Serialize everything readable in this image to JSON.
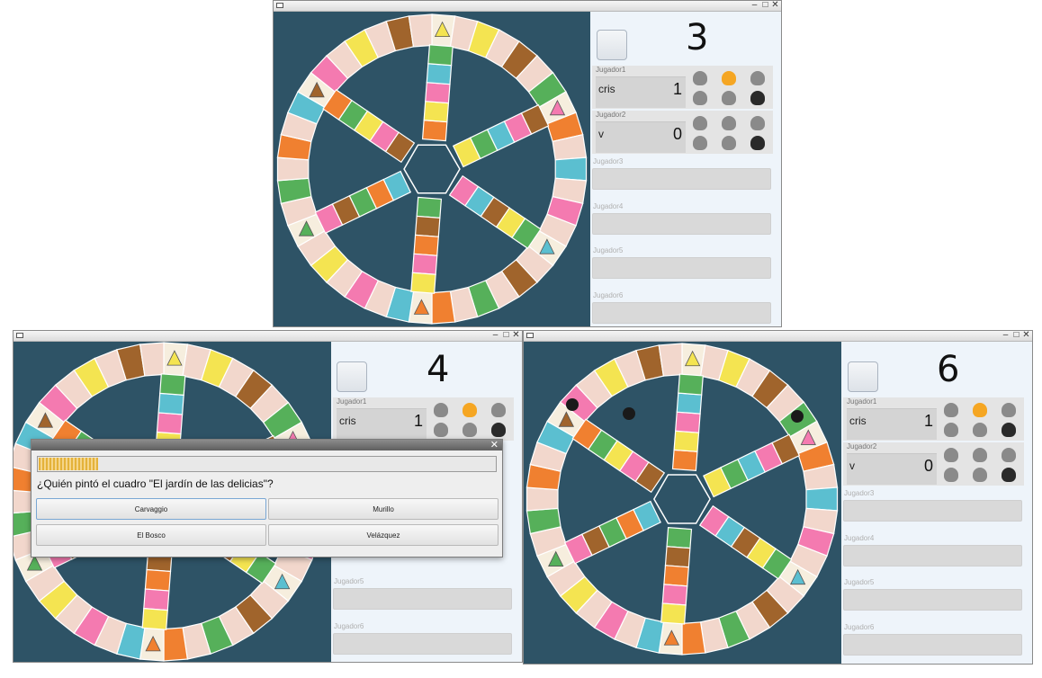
{
  "windows": [
    {
      "id": "top",
      "dice_value": "3",
      "players": [
        {
          "label": "Jugador1",
          "name": "cris",
          "score": "1",
          "wedges": [
            "grey",
            "orange",
            "grey",
            "grey",
            "grey",
            "black"
          ]
        },
        {
          "label": "Jugador2",
          "name": "v",
          "score": "0",
          "wedges": [
            "grey",
            "grey",
            "grey",
            "grey",
            "grey",
            "black"
          ]
        }
      ],
      "empty_slots": [
        "Jugador3",
        "Jugador4",
        "Jugador5",
        "Jugador6"
      ]
    },
    {
      "id": "bottom-left",
      "dice_value": "4",
      "players": [
        {
          "label": "Jugador1",
          "name": "cris",
          "score": "1",
          "wedges": [
            "grey",
            "orange",
            "grey",
            "grey",
            "grey",
            "black"
          ]
        }
      ],
      "empty_slots": [
        "Jugador5",
        "Jugador6"
      ]
    },
    {
      "id": "bottom-right",
      "dice_value": "6",
      "players": [
        {
          "label": "Jugador1",
          "name": "cris",
          "score": "1",
          "wedges": [
            "grey",
            "orange",
            "grey",
            "grey",
            "grey",
            "black"
          ]
        },
        {
          "label": "Jugador2",
          "name": "v",
          "score": "0",
          "wedges": [
            "grey",
            "grey",
            "grey",
            "grey",
            "grey",
            "black"
          ]
        }
      ],
      "empty_slots": [
        "Jugador3",
        "Jugador4",
        "Jugador5",
        "Jugador6"
      ]
    }
  ],
  "question_dialog": {
    "timer_progress": 0.13,
    "question": "¿Quién pintó el cuadro \"El jardín de las delicias\"?",
    "answers": [
      "Carvaggio",
      "Murillo",
      "El Bosco",
      "Velázquez"
    ]
  },
  "colors": {
    "board_bg": "#2e5366",
    "pink": "#f47ab0",
    "blue": "#5bbfd0",
    "yellow": "#f4e451",
    "brown": "#a0642c",
    "green": "#56b05a",
    "orange": "#f08030",
    "blank": "#f2d7cc"
  },
  "icons": {
    "window": "window-icon",
    "minimize": "minimize-icon",
    "maximize": "maximize-icon",
    "close": "close-icon",
    "category_wedge": "category-wedge-icon",
    "player_token": "player-token-icon"
  }
}
